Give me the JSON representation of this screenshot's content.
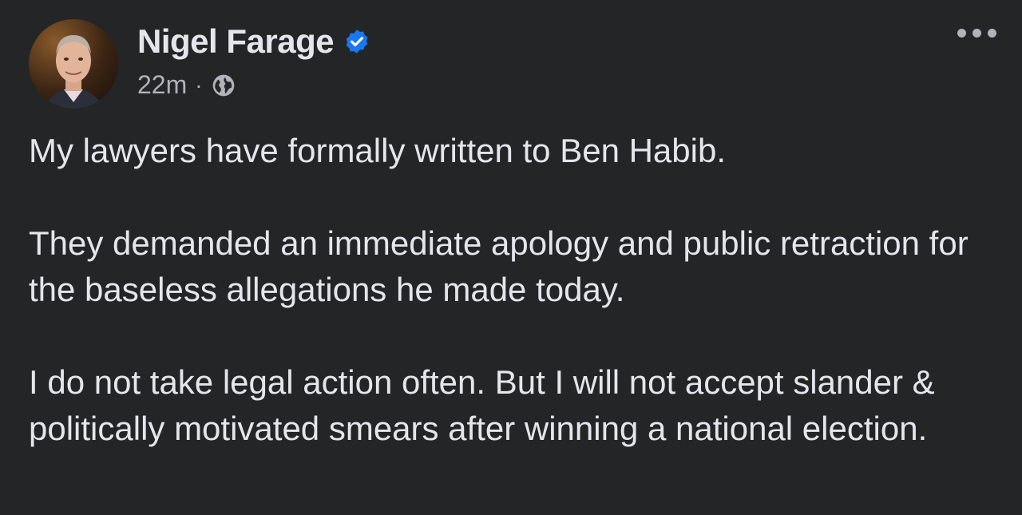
{
  "post": {
    "author": "Nigel Farage",
    "timestamp": "22m",
    "separator": "·",
    "audience_icon": "globe-icon",
    "verified_icon": "verified-badge-icon",
    "more_icon": "more-options-icon",
    "paragraphs": [
      "My lawyers have formally written to Ben Habib.",
      "They demanded an immediate apology and public retraction for the baseless allegations he made today.",
      "I do not take legal action often. But I will not accept slander & politically motivated smears after winning a national election."
    ]
  },
  "colors": {
    "background": "#242526",
    "primary_text": "#e4e6eb",
    "secondary_text": "#b0b3b8",
    "verified": "#1877f2"
  }
}
